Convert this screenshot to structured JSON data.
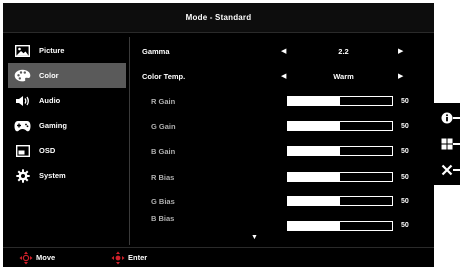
{
  "title": "Mode - Standard",
  "sidebar": {
    "items": [
      {
        "label": "Picture",
        "icon": "picture-icon"
      },
      {
        "label": "Color",
        "icon": "palette-icon",
        "selected": true
      },
      {
        "label": "Audio",
        "icon": "speaker-icon"
      },
      {
        "label": "Gaming",
        "icon": "gamepad-icon"
      },
      {
        "label": "OSD",
        "icon": "osd-window-icon"
      },
      {
        "label": "System",
        "icon": "gear-icon"
      }
    ]
  },
  "settings": {
    "gamma": {
      "label": "Gamma",
      "value": "2.2"
    },
    "color_temp": {
      "label": "Color Temp.",
      "value": "Warm"
    },
    "r_gain": {
      "label": "R Gain",
      "value": "50",
      "level": 0.5
    },
    "g_gain": {
      "label": "G Gain",
      "value": "50",
      "level": 0.5
    },
    "b_gain": {
      "label": "B Gain",
      "value": "50",
      "level": 0.5
    },
    "r_bias": {
      "label": "R Bias",
      "value": "50",
      "level": 0.5
    },
    "g_bias": {
      "label": "G Bias",
      "value": "50",
      "level": 0.5
    },
    "b_bias": {
      "label": "B Bias",
      "value": "50",
      "level": 0.5
    }
  },
  "footer": {
    "move": "Move",
    "enter": "Enter"
  },
  "hotkeys": [
    {
      "icon": "info-icon"
    },
    {
      "icon": "menu-grid-icon"
    },
    {
      "icon": "close-icon"
    }
  ],
  "colors": {
    "background": "#000000",
    "selected": "#5a5a5a",
    "dpad_accent": "#d0202a",
    "text": "#ffffff"
  }
}
